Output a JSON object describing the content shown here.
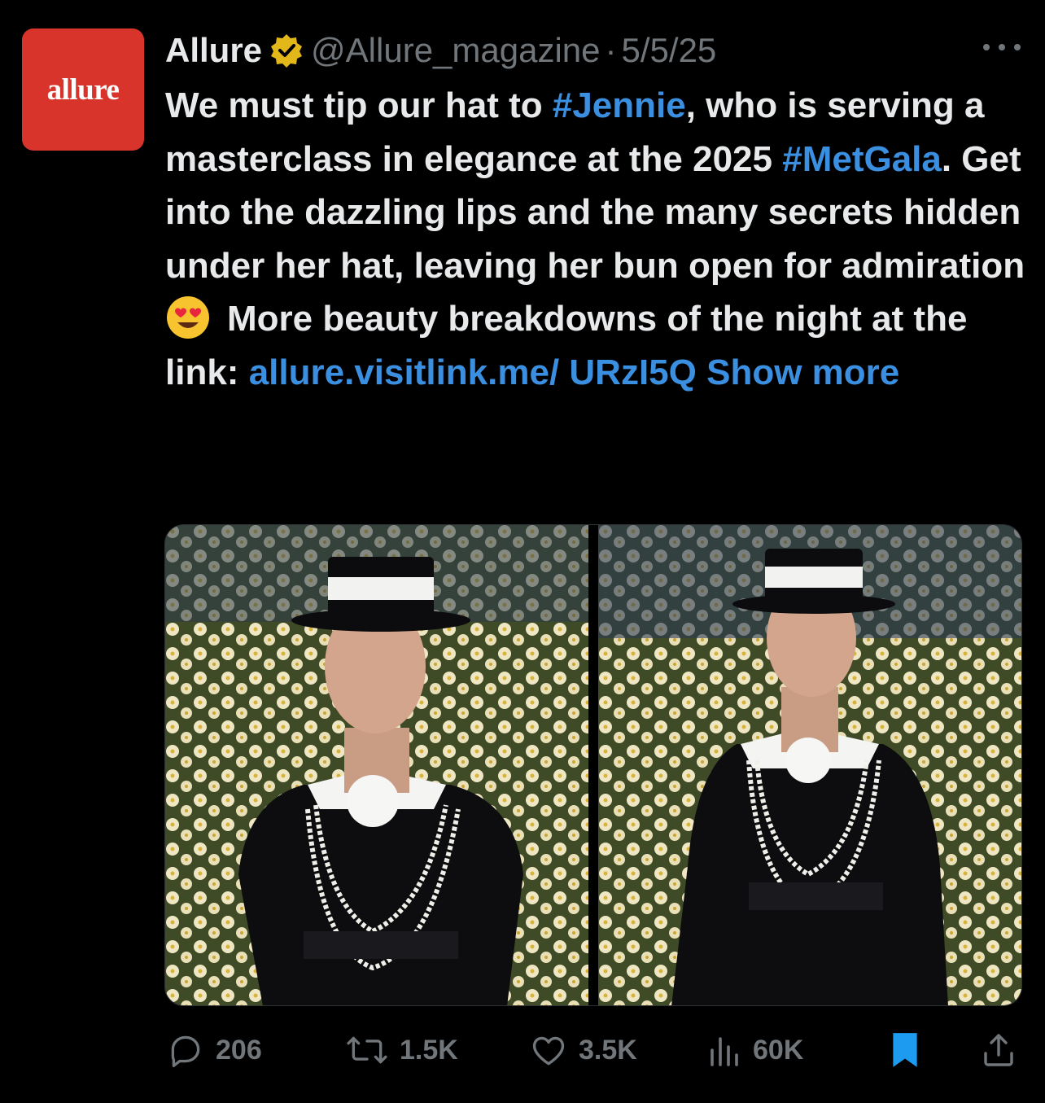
{
  "tweet": {
    "avatar_text": "allure",
    "author_name": "Allure",
    "handle": "@Allure_magazine",
    "separator": "·",
    "date": "5/5/25",
    "text": {
      "p1": "We must tip our hat to ",
      "tag1": "#Jennie",
      "p2": ", who is serving a masterclass in elegance at the 2025 ",
      "tag2": "#MetGala",
      "p3": ". Get into the dazzling lips and the many secrets hidden under her hat, leaving her bun open for admiration ",
      "p4": "More beauty breakdowns of the night at the link: ",
      "link": "allure.visitlink.me/ URzI5Q",
      "show_more": "Show more"
    }
  },
  "stats": {
    "replies": "206",
    "reposts": "1.5K",
    "likes": "3.5K",
    "views": "60K"
  },
  "icons": {
    "verified": "verified-gold-badge",
    "emoji": "heart-eyes-emoji",
    "reply": "reply-icon",
    "repost": "repost-icon",
    "like": "like-icon",
    "views": "views-icon",
    "bookmark": "bookmark-icon",
    "share": "share-icon"
  },
  "colors": {
    "background": "#000000",
    "text": "#e7e9ea",
    "secondary": "#71767b",
    "link": "#3b8fe0",
    "avatar_bg": "#d9342b",
    "verified": "#e2b719",
    "bookmark_active": "#1d9bf0"
  }
}
